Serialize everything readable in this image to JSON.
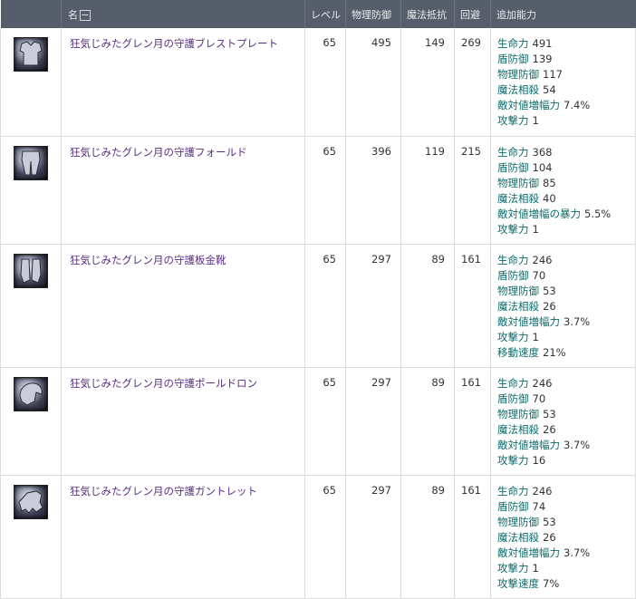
{
  "header": {
    "name": "名",
    "toggle": "−",
    "level": "レベル",
    "physical_defense": "物理防御",
    "magic_resist": "魔法抵抗",
    "evasion": "回避",
    "bonus": "追加能力"
  },
  "items": [
    {
      "icon": "breastplate-icon",
      "name": "狂気じみたグレン月の守護ブレストプレート",
      "level": "65",
      "pdef": "495",
      "mres": "149",
      "eva": "269",
      "stats": [
        {
          "label": "生命力",
          "value": "491"
        },
        {
          "label": "盾防御",
          "value": "139"
        },
        {
          "label": "物理防御",
          "value": "117"
        },
        {
          "label": "魔法相殺",
          "value": "54"
        },
        {
          "label": "敵対値増幅力",
          "value": "7.4%"
        },
        {
          "label": "攻撃力",
          "value": "1"
        }
      ]
    },
    {
      "icon": "leggings-icon",
      "name": "狂気じみたグレン月の守護フォールド",
      "level": "65",
      "pdef": "396",
      "mres": "119",
      "eva": "215",
      "stats": [
        {
          "label": "生命力",
          "value": "368"
        },
        {
          "label": "盾防御",
          "value": "104"
        },
        {
          "label": "物理防御",
          "value": "85"
        },
        {
          "label": "魔法相殺",
          "value": "40"
        },
        {
          "label": "敵対値増幅の暴力",
          "value": "5.5%"
        },
        {
          "label": "攻撃力",
          "value": "1"
        }
      ]
    },
    {
      "icon": "greaves-icon",
      "name": "狂気じみたグレン月の守護板金靴",
      "level": "65",
      "pdef": "297",
      "mres": "89",
      "eva": "161",
      "stats": [
        {
          "label": "生命力",
          "value": "246"
        },
        {
          "label": "盾防御",
          "value": "70"
        },
        {
          "label": "物理防御",
          "value": "53"
        },
        {
          "label": "魔法相殺",
          "value": "26"
        },
        {
          "label": "敵対値増幅力",
          "value": "3.7%"
        },
        {
          "label": "攻撃力",
          "value": "1"
        },
        {
          "label": "移動速度",
          "value": "21%"
        }
      ]
    },
    {
      "icon": "pauldron-icon",
      "name": "狂気じみたグレン月の守護ポールドロン",
      "level": "65",
      "pdef": "297",
      "mres": "89",
      "eva": "161",
      "stats": [
        {
          "label": "生命力",
          "value": "246"
        },
        {
          "label": "盾防御",
          "value": "70"
        },
        {
          "label": "物理防御",
          "value": "53"
        },
        {
          "label": "魔法相殺",
          "value": "26"
        },
        {
          "label": "敵対値増幅力",
          "value": "3.7%"
        },
        {
          "label": "攻撃力",
          "value": "16"
        }
      ]
    },
    {
      "icon": "gauntlet-icon",
      "name": "狂気じみたグレン月の守護ガントレット",
      "level": "65",
      "pdef": "297",
      "mres": "89",
      "eva": "161",
      "stats": [
        {
          "label": "生命力",
          "value": "246"
        },
        {
          "label": "盾防御",
          "value": "74"
        },
        {
          "label": "物理防御",
          "value": "53"
        },
        {
          "label": "魔法相殺",
          "value": "26"
        },
        {
          "label": "敵対値増幅力",
          "value": "3.7%"
        },
        {
          "label": "攻撃力",
          "value": "1"
        },
        {
          "label": "攻撃速度",
          "value": "7%"
        }
      ]
    }
  ]
}
